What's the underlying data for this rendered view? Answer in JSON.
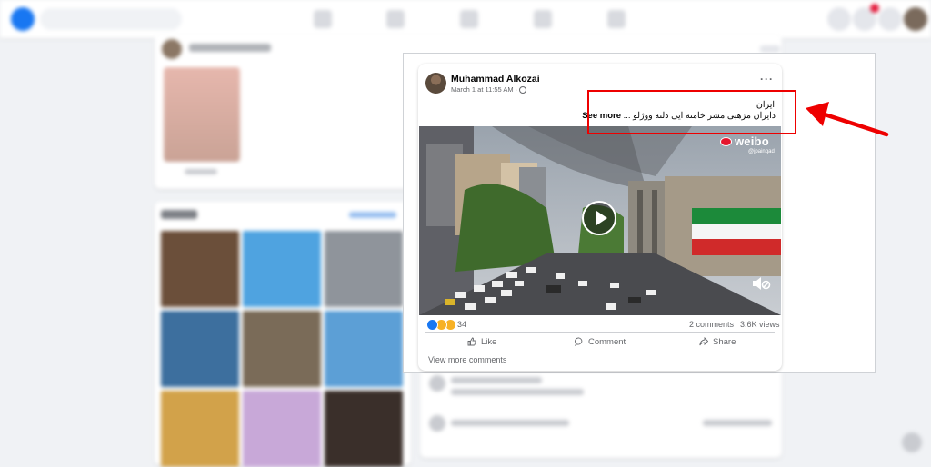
{
  "post": {
    "author": "Muhammad Alkozai",
    "timestamp": "March 1 at 11:55 AM",
    "more_menu": "···",
    "text_line1": "ایران",
    "text_line2_rtl": "دایران مزهبی مشر خامنه ایی دلته ووژلو ...",
    "see_more": "See more",
    "video_watermark": "weibo",
    "video_watermark_sub": "@jpaingad",
    "reaction_count": "34",
    "comments": "2 comments",
    "views": "3.6K views",
    "actions": {
      "like": "Like",
      "comment": "Comment",
      "share": "Share"
    },
    "view_more_comments": "View more comments",
    "reactions": [
      "like",
      "care",
      "wow"
    ]
  },
  "annotation": {
    "highlight_color": "#ee0000",
    "arrow_color": "#ee0000"
  },
  "colors": {
    "brand_blue": "#1877f2",
    "secondary_text": "#65676b",
    "notification_badge": "#e41e3f"
  }
}
